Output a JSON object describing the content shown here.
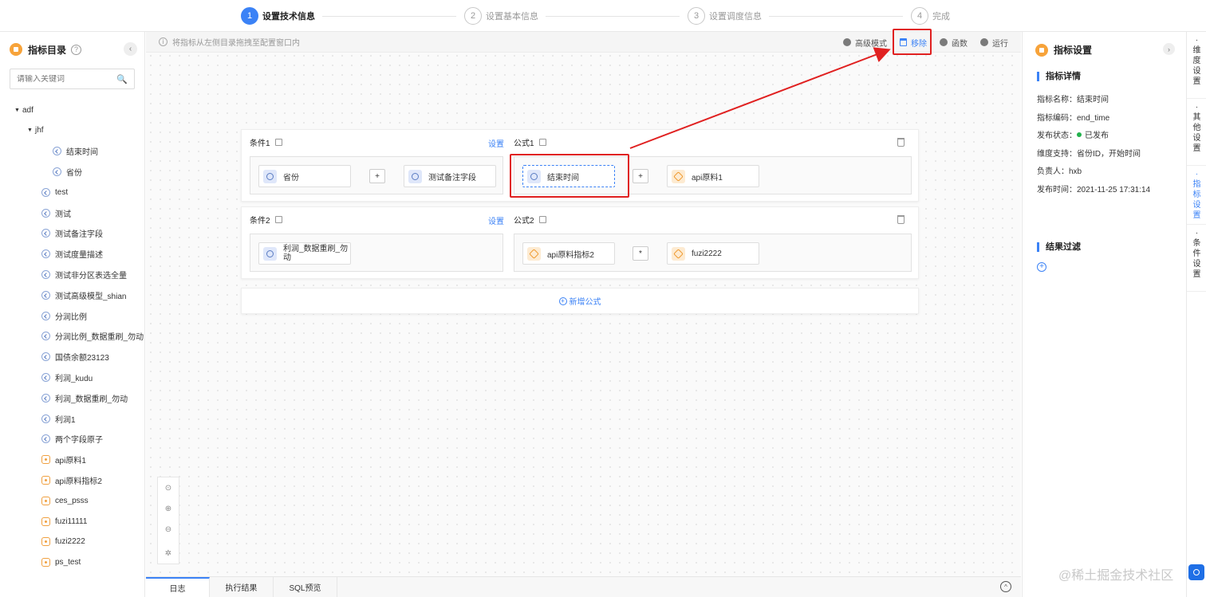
{
  "steps": [
    {
      "num": "1",
      "label": "设置技术信息"
    },
    {
      "num": "2",
      "label": "设置基本信息"
    },
    {
      "num": "3",
      "label": "设置调度信息"
    },
    {
      "num": "4",
      "label": "完成"
    }
  ],
  "sidebar": {
    "title": "指标目录",
    "help": "?",
    "collapse": "‹",
    "search_placeholder": "请输入关键词",
    "search_icon": "🔍",
    "tree": [
      {
        "label": "adf",
        "type": "folder",
        "caret": "▼"
      },
      {
        "label": "jhf",
        "type": "folder",
        "caret": "▼"
      },
      {
        "label": "结束时间",
        "type": "dim"
      },
      {
        "label": "省份",
        "type": "dim"
      },
      {
        "label": "test",
        "type": "dim"
      },
      {
        "label": "测试",
        "type": "dim"
      },
      {
        "label": "测试备注字段",
        "type": "dim"
      },
      {
        "label": "测试度量描述",
        "type": "dim"
      },
      {
        "label": "测试非分区表选全量",
        "type": "dim"
      },
      {
        "label": "测试高级模型_shian",
        "type": "dim"
      },
      {
        "label": "分润比例",
        "type": "dim"
      },
      {
        "label": "分润比例_数据重刷_勿动",
        "type": "dim"
      },
      {
        "label": "国债余额23123",
        "type": "dim"
      },
      {
        "label": "利润_kudu",
        "type": "dim"
      },
      {
        "label": "利润_数据重刷_勿动",
        "type": "dim"
      },
      {
        "label": "利润1",
        "type": "dim"
      },
      {
        "label": "两个字段原子",
        "type": "dim"
      },
      {
        "label": "api原料1",
        "type": "metric"
      },
      {
        "label": "api原料指标2",
        "type": "metric"
      },
      {
        "label": "ces_psss",
        "type": "metric"
      },
      {
        "label": "fuzi11111",
        "type": "metric"
      },
      {
        "label": "fuzi2222",
        "type": "metric"
      },
      {
        "label": "ps_test",
        "type": "metric"
      }
    ]
  },
  "toolbar": {
    "tip_icon": "i",
    "tip": "将指标从左侧目录拖拽至配置窗口内",
    "advanced": "高级模式",
    "remove": "移除",
    "function": "函数",
    "run": "运行"
  },
  "rows": [
    {
      "condition_label": "条件1",
      "setting": "设置",
      "formula_label": "公式1",
      "condition_chips": [
        "省份",
        "测试备注字段"
      ],
      "condition_op": "+",
      "formula_chips": [
        "结束时间",
        "api原料1"
      ],
      "formula_op": "+"
    },
    {
      "condition_label": "条件2",
      "setting": "设置",
      "formula_label": "公式2",
      "condition_chips": [
        "利润_数据重刷_勿动"
      ],
      "formula_chips": [
        "api原料指标2",
        "fuzi2222"
      ],
      "formula_op": "*"
    }
  ],
  "add_formula": {
    "icon": "+",
    "label": "新增公式"
  },
  "zoom_tools": [
    "⊙",
    "⊕",
    "⊖",
    "✲"
  ],
  "bottom_tabs": [
    "日志",
    "执行结果",
    "SQL预览"
  ],
  "bottom_up": "^",
  "right_panel": {
    "title": "指标设置",
    "collapse": "›",
    "detail_title": "指标详情",
    "name": "指标名称：结束时间",
    "code": "指标编码：end_time",
    "status_label": "发布状态：",
    "status_value": "已发布",
    "dimensions": "维度支持：省份ID，开始时间",
    "owner": "负责人：hxb",
    "publish_time": "发布时间：2021-11-25 17:31:14",
    "filter_title": "结果过滤",
    "filter_add": "+"
  },
  "vertical_tabs": [
    "维度设置",
    "其他设置",
    "指标设置",
    "条件设置"
  ],
  "watermark": "@稀土掘金技术社区",
  "colors": {
    "accent": "#3b82f6",
    "highlight": "#e02020",
    "published": "#22b14c"
  }
}
